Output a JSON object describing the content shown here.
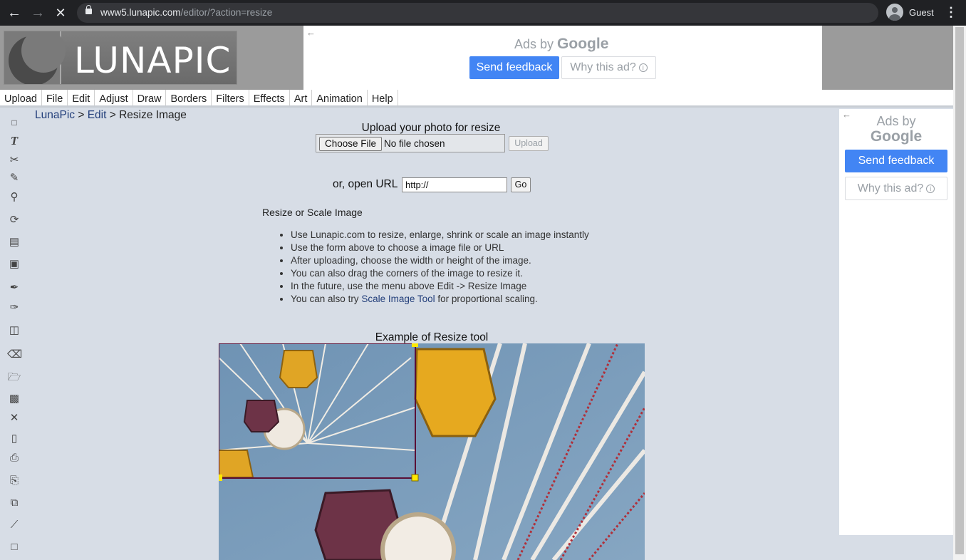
{
  "browser": {
    "url_host": "www5.lunapic.com",
    "url_path": "/editor/?action=resize",
    "profile_name": "Guest"
  },
  "header": {
    "logo_text": "LUNAPIC"
  },
  "ad_top": {
    "ads_by": "Ads by",
    "google": "Google",
    "send_feedback": "Send feedback",
    "why_this_ad": "Why this ad?"
  },
  "menu": [
    {
      "label": "Upload"
    },
    {
      "label": "File"
    },
    {
      "label": "Edit"
    },
    {
      "label": "Adjust"
    },
    {
      "label": "Draw"
    },
    {
      "label": "Borders"
    },
    {
      "label": "Filters"
    },
    {
      "label": "Effects"
    },
    {
      "label": "Art"
    },
    {
      "label": "Animation"
    },
    {
      "label": "Help"
    }
  ],
  "toolbar_icons": [
    "marquee-select-icon",
    "text-tool-icon",
    "scissors-icon",
    "pencil-icon",
    "magnifier-icon",
    "rotate-icon",
    "gradient-icon",
    "paint-bucket-icon",
    "eyedropper-icon",
    "brush-icon",
    "layers-icon",
    "eraser-icon",
    "open-folder-icon",
    "save-icon",
    "close-icon",
    "new-file-icon",
    "print-icon",
    "paste-icon",
    "copy-icon",
    "line-icon",
    "rectangle-icon"
  ],
  "breadcrumb": {
    "home": "LunaPic",
    "sep1": " > ",
    "section": "Edit",
    "sep2": " > ",
    "current": "Resize Image"
  },
  "upload": {
    "title": "Upload your photo for resize",
    "choose_file": "Choose File",
    "no_file": "No file chosen",
    "upload_button": "Upload",
    "or_open_url": "or, open URL",
    "url_value": "http://",
    "go_button": "Go"
  },
  "info": {
    "title": "Resize or Scale Image",
    "bullets": [
      "Use Lunapic.com to resize, enlarge, shrink or scale an image instantly",
      "Use the form above to choose a image file or URL",
      "After uploading, choose the width or height of the image.",
      "You can also drag the corners of the image to resize it.",
      "In the future, use the menu above Edit -> Resize Image"
    ],
    "last_prefix": "You can also try ",
    "last_link": "Scale Image Tool",
    "last_suffix": " for proportional scaling."
  },
  "example": {
    "title": "Example of Resize tool"
  },
  "ad_right": {
    "ads_by": "Ads by",
    "google": "Google",
    "send_feedback": "Send feedback",
    "why_this_ad": "Why this ad?"
  }
}
